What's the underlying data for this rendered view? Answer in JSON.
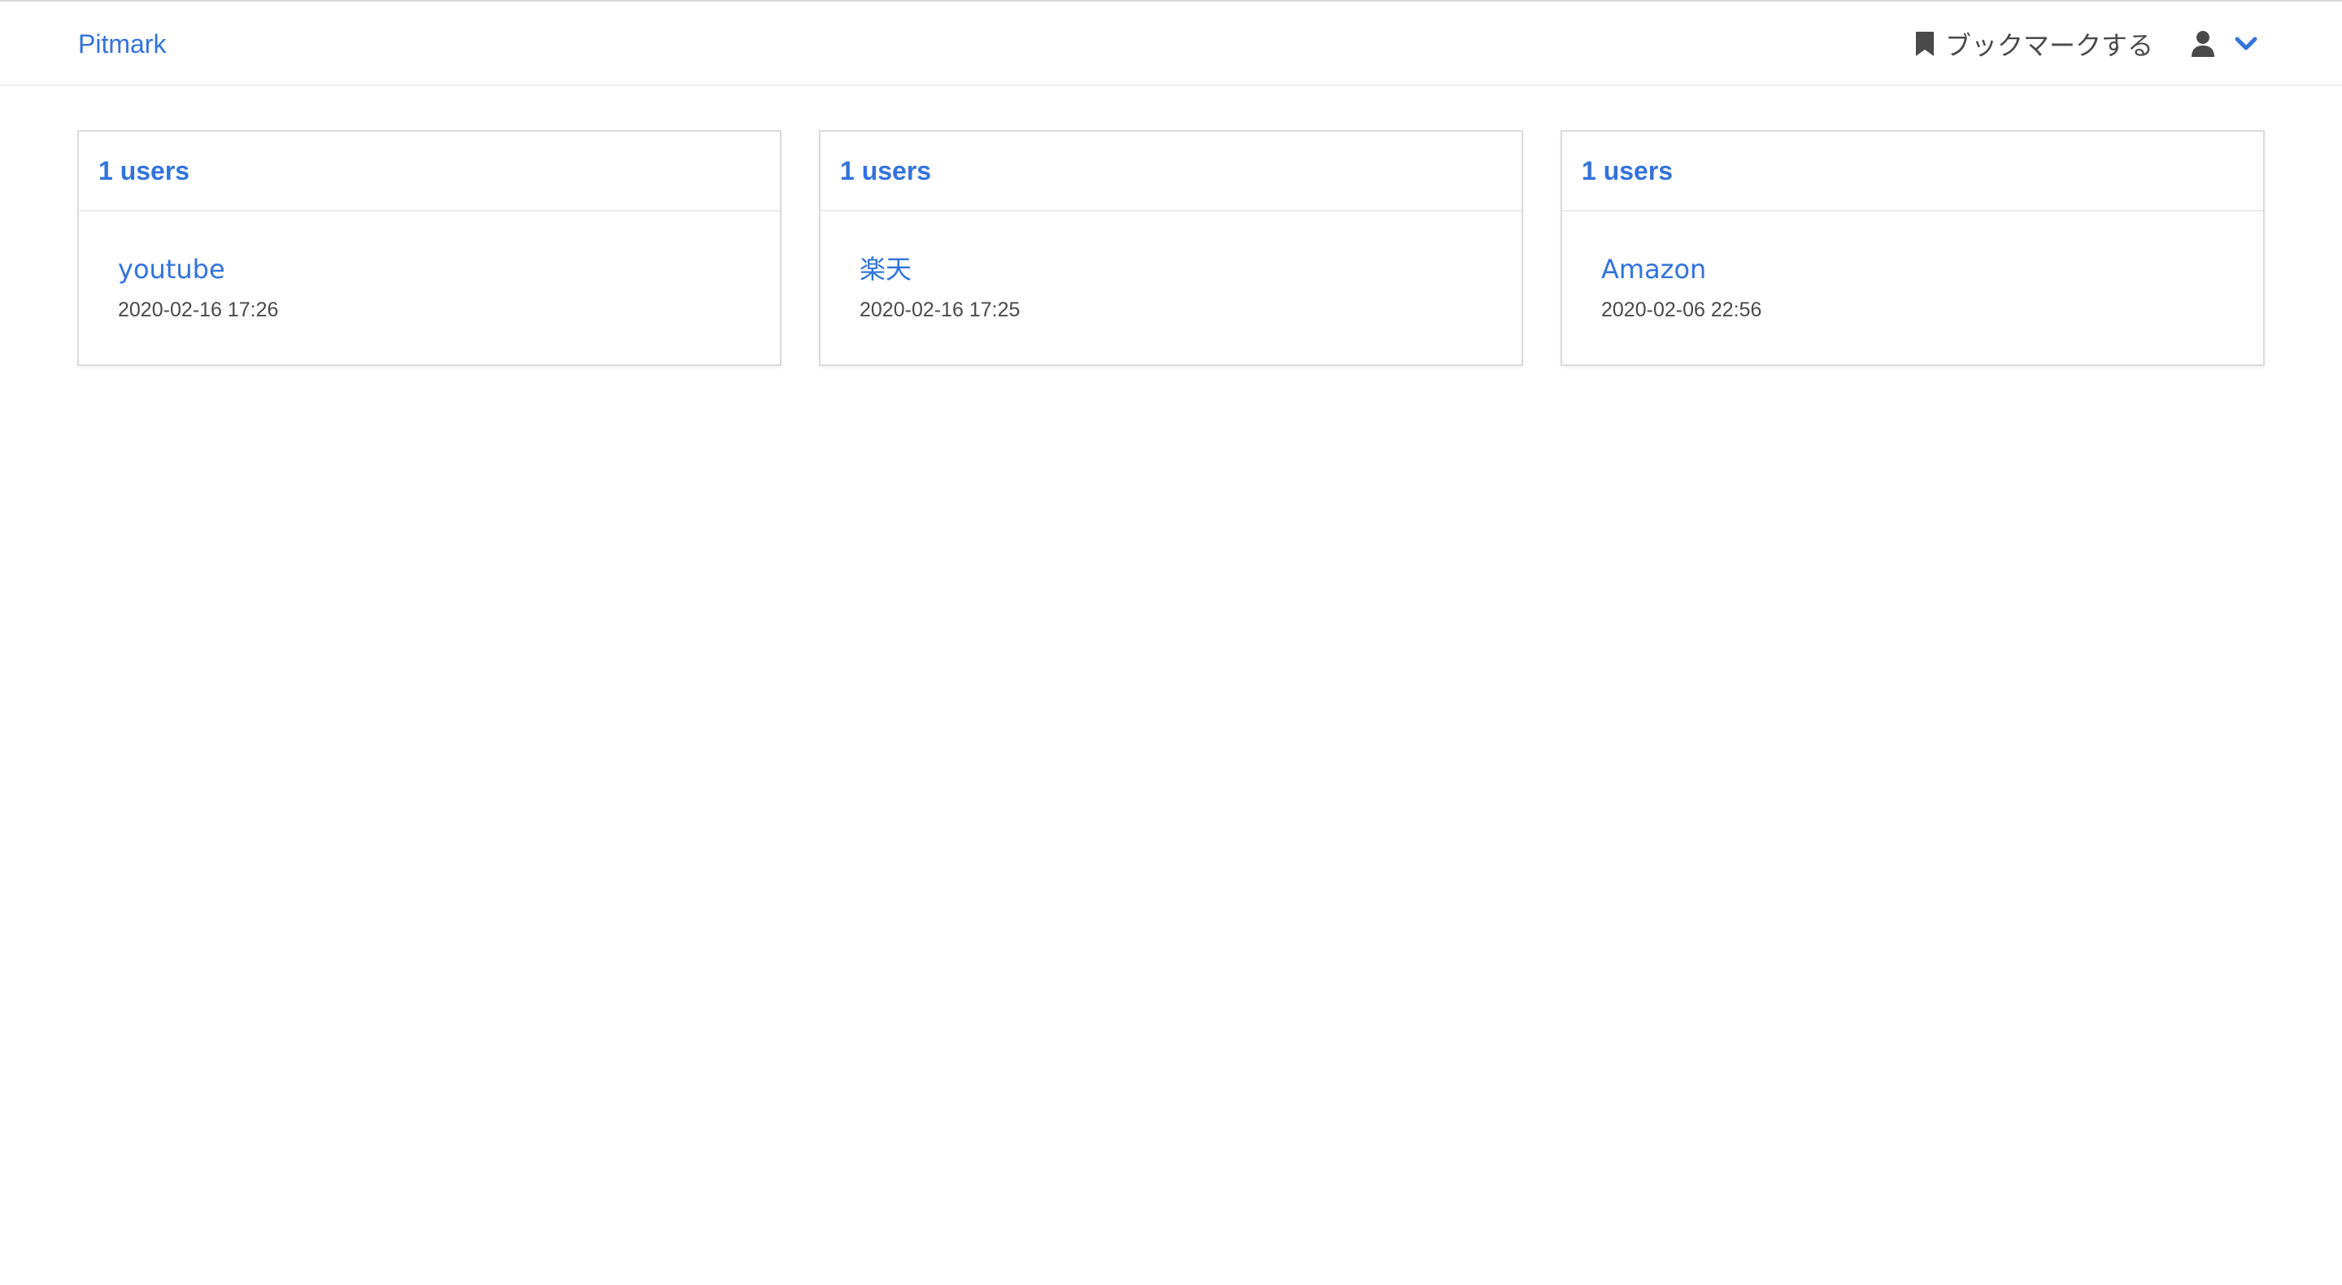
{
  "navbar": {
    "brand": "Pitmark",
    "bookmark_label": "ブックマークする",
    "icons": {
      "bookmark": "bookmark-icon",
      "user": "user-icon",
      "chevron": "chevron-down-icon"
    }
  },
  "colors": {
    "accent": "#3273dc",
    "text": "#4a4a4a",
    "border": "#dbdbdb"
  },
  "cards": [
    {
      "header": "1 users",
      "site": "youtube",
      "date": "2020-02-16 17:26"
    },
    {
      "header": "1 users",
      "site": "楽天",
      "date": "2020-02-16 17:25"
    },
    {
      "header": "1 users",
      "site": "Amazon",
      "date": "2020-02-06 22:56"
    }
  ]
}
